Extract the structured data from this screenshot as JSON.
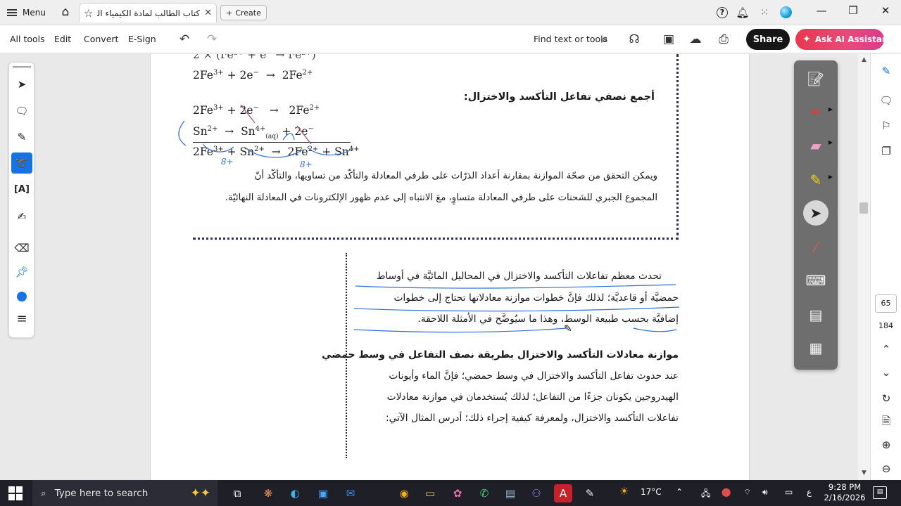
{
  "titlebar": {
    "menu_label": "Menu",
    "tab_title": "كتاب الطالب لمادة الكيمياء الث..",
    "tab_close": "✕",
    "create_label": "Create",
    "win_min": "—",
    "win_max": "❐",
    "win_close": "✕"
  },
  "toolbar": {
    "all_tools": "All tools",
    "edit": "Edit",
    "convert": "Convert",
    "esign": "E-Sign",
    "find": "Find text or tools",
    "share": "Share",
    "ai_assistant": "Ask AI Assistant"
  },
  "document": {
    "eq_top_partial": "2 × (Fe³⁺ + e⁻ → Fe²⁺)",
    "eq1": {
      "a": "2Fe",
      "a_sup": "3+",
      "b": " + 2e",
      "b_sup": "−",
      "arrow": "  →  ",
      "c": "2Fe",
      "c_sup": "2+"
    },
    "heading_combine": "أجمع نصفي تفاعل التأكسد والاختزال:",
    "eq2": {
      "a": "2Fe",
      "a_sup": "3+",
      "b": " + ",
      "c": "2e",
      "c_sup": "−",
      "arrow": "   →   ",
      "d": "2Fe",
      "d_sup": "2+"
    },
    "eq3": {
      "a": "Sn",
      "a_sup": "2+",
      "arrow": "  →  ",
      "b": "Sn",
      "b_sup": "4+",
      "b_sub": "(aq)",
      "c": " + ",
      "d": "2e",
      "d_sup": "−"
    },
    "eq4": {
      "a": "2Fe",
      "a_sup": "3+",
      "b": " + Sn",
      "b_sup": "2+",
      "arrow": "  →  ",
      "c": "2Fe",
      "c_sup": "2+",
      "d": " + Sn",
      "d_sup": "4+"
    },
    "para_check_1": "ويمكن التحقق من صحّة الموازنة بمقارنة أعداد الذرّات على طرفي المعادلة والتأكّد من تساويها، والتأكّد أنّ",
    "para_check_2": "المجموع الجبري للشحنات على طرفي المعادلة متساوٍ، معَ الانتباه إلى عدم ظهور الإلكترونات في المعادلة النهائيّة.",
    "para_media_1": "تحدث معظم تفاعلات التأكسد والاختزال في المحاليل المائيَّة في أوساط",
    "para_media_2": "حمضيَّة أو قاعديَّة؛ لذلك فإنَّ خطوات موازنة معادلاتها تحتاج إلى خطوات",
    "para_media_3": "إضافيَّة بحسب طبيعة الوسط، وهذا ما سيُوضَّح في الأمثلة اللاحقة.",
    "heading_acidic": "موازنة معادلات التأكسد والاختزال بطريقة نصف التفاعل في وسط حمضي",
    "para_acidic_1": "عند حدوث تفاعل التأكسد والاختزال في وسط حمضي؛ فإنَّ الماء وأيونات",
    "para_acidic_2": "الهيدروجين يكونان جزءًا من التفاعل؛ لذلك يُستخدمان في موازنة معادلات",
    "para_acidic_3": "تفاعلات التأكسد والاختزال، ولمعرفة كيفية إجراء ذلك؛ أدرس المثال الآتي:",
    "annot_8plus_1": "8+",
    "annot_8plus_2": "8+"
  },
  "right_rail": {
    "page_current": "65",
    "page_total": "184"
  },
  "taskbar": {
    "search_placeholder": "Type here to search",
    "weather_temp": "17°C",
    "lang": "ع",
    "time": "9:28 PM",
    "date": "2/16/2026"
  },
  "colors": {
    "accent": "#1473e6",
    "share_bg": "#161616",
    "ai_gradient_start": "#e8384f",
    "annotation_ink": "#2f6fd6",
    "palette_bg": "#6e6e6e",
    "taskbar_bg": "#1f1f28"
  },
  "icons": {
    "rail": [
      "select-arrow-icon",
      "comment-icon",
      "highlight-icon",
      "freehand-draw-icon",
      "text-select-icon",
      "fill-sign-icon",
      "eraser-icon",
      "pin-icon",
      "color-dot-icon",
      "more-lines-icon"
    ],
    "palette": [
      "notepad-icon",
      "red-pen-icon",
      "eraser-icon",
      "highlighter-icon",
      "cursor-icon",
      "laser-pointer-icon",
      "keyboard-icon",
      "screen-capture-icon",
      "window-capture-icon"
    ]
  }
}
